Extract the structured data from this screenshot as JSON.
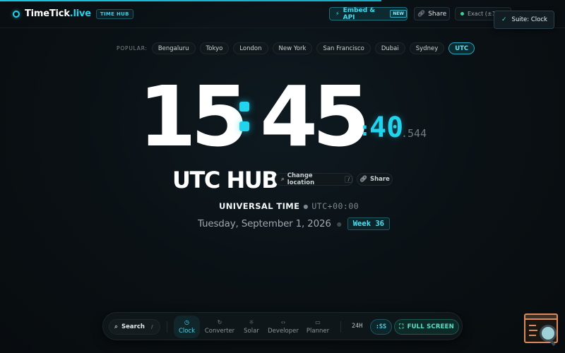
{
  "brand": {
    "name": "TimeTick",
    "tld": ".live",
    "badge": "TIME HUB"
  },
  "header": {
    "embed_label": "Embed & API",
    "embed_badge": "NEW",
    "share_label": "Share",
    "exact_label": "Exact (±16"
  },
  "toast": {
    "text": "Suite: Clock"
  },
  "cities": {
    "label": "POPULAR:",
    "items": [
      "Bengaluru",
      "Tokyo",
      "London",
      "New York",
      "San Francisco",
      "Dubai",
      "Sydney",
      "UTC"
    ],
    "active": "UTC"
  },
  "clock": {
    "hours": "15",
    "minutes": "45",
    "seconds": "40",
    "ms": ".544"
  },
  "location": {
    "title": "UTC HUB",
    "change_label": "Change location",
    "change_kbd": "/",
    "share_label": "Share",
    "tz_name": "UNIVERSAL TIME",
    "tz_offset": "UTC+00:00",
    "date": "Tuesday, September 1, 2026",
    "week": "Week 36"
  },
  "dock": {
    "search_label": "Search",
    "search_kbd": "/",
    "tabs": [
      {
        "label": "Clock",
        "icon": "clock-icon"
      },
      {
        "label": "Converter",
        "icon": "refresh-icon"
      },
      {
        "label": "Solar",
        "icon": "sun-icon"
      },
      {
        "label": "Developer",
        "icon": "code-icon"
      },
      {
        "label": "Planner",
        "icon": "calendar-icon"
      }
    ],
    "active_tab": "Clock",
    "format_label": "24H",
    "seconds_label": ":SS",
    "fullscreen_label": "FULL SCREEN"
  },
  "colors": {
    "accent": "#22d3ee",
    "background": "#0a1014",
    "success": "#34d399",
    "widget": "#d98b5f"
  }
}
